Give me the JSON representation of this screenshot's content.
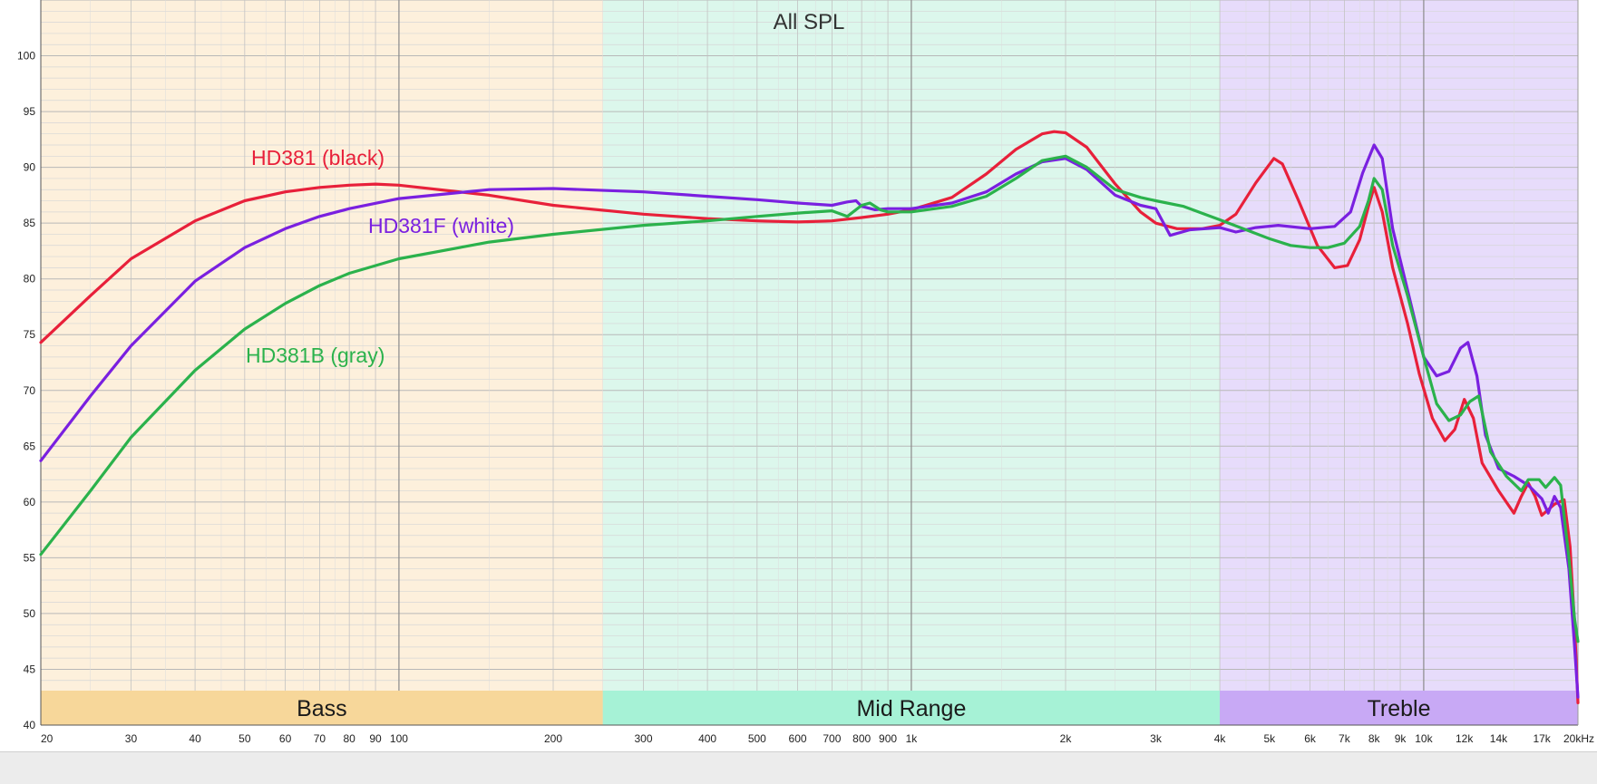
{
  "chart_data": {
    "type": "line",
    "title": "All SPL",
    "xscale": "log",
    "xlim": [
      20,
      20000
    ],
    "ylim": [
      40,
      105
    ],
    "grid": true,
    "y_ticks": [
      "40",
      "45",
      "50",
      "55",
      "60",
      "65",
      "70",
      "75",
      "80",
      "85",
      "90",
      "95",
      "100"
    ],
    "x_ticks": [
      {
        "v": 20,
        "label": "20"
      },
      {
        "v": 30,
        "label": "30"
      },
      {
        "v": 40,
        "label": "40"
      },
      {
        "v": 50,
        "label": "50"
      },
      {
        "v": 60,
        "label": "60"
      },
      {
        "v": 70,
        "label": "70"
      },
      {
        "v": 80,
        "label": "80"
      },
      {
        "v": 90,
        "label": "90"
      },
      {
        "v": 100,
        "label": "100"
      },
      {
        "v": 200,
        "label": "200"
      },
      {
        "v": 300,
        "label": "300"
      },
      {
        "v": 400,
        "label": "400"
      },
      {
        "v": 500,
        "label": "500"
      },
      {
        "v": 600,
        "label": "600"
      },
      {
        "v": 700,
        "label": "700"
      },
      {
        "v": 800,
        "label": "800"
      },
      {
        "v": 900,
        "label": "900"
      },
      {
        "v": 1000,
        "label": "1k"
      },
      {
        "v": 2000,
        "label": "2k"
      },
      {
        "v": 3000,
        "label": "3k"
      },
      {
        "v": 4000,
        "label": "4k"
      },
      {
        "v": 5000,
        "label": "5k"
      },
      {
        "v": 6000,
        "label": "6k"
      },
      {
        "v": 7000,
        "label": "7k"
      },
      {
        "v": 8000,
        "label": "8k"
      },
      {
        "v": 9000,
        "label": "9k"
      },
      {
        "v": 10000,
        "label": "10k"
      },
      {
        "v": 12000,
        "label": "12k"
      },
      {
        "v": 14000,
        "label": "14k"
      },
      {
        "v": 17000,
        "label": "17k"
      },
      {
        "v": 20000,
        "label": "20kHz"
      }
    ],
    "bands": [
      {
        "label": "Bass",
        "from": 20,
        "to": 250,
        "fill": "#fdf0dc",
        "bar": "#f7d79a"
      },
      {
        "label": "Mid Range",
        "from": 250,
        "to": 4000,
        "fill": "#dcf7ec",
        "bar": "#a6f2d6"
      },
      {
        "label": "Treble",
        "from": 4000,
        "to": 20000,
        "fill": "#e7dcfb",
        "bar": "#c8a9f5"
      }
    ],
    "series": [
      {
        "name": "HD381 (black)",
        "color": "#e8203a",
        "points": [
          [
            20,
            74.3
          ],
          [
            25,
            78.5
          ],
          [
            30,
            81.8
          ],
          [
            40,
            85.2
          ],
          [
            50,
            87.0
          ],
          [
            60,
            87.8
          ],
          [
            70,
            88.2
          ],
          [
            80,
            88.4
          ],
          [
            90,
            88.5
          ],
          [
            100,
            88.4
          ],
          [
            150,
            87.5
          ],
          [
            200,
            86.6
          ],
          [
            300,
            85.8
          ],
          [
            400,
            85.4
          ],
          [
            500,
            85.2
          ],
          [
            600,
            85.1
          ],
          [
            700,
            85.2
          ],
          [
            800,
            85.5
          ],
          [
            900,
            85.8
          ],
          [
            1000,
            86.2
          ],
          [
            1200,
            87.3
          ],
          [
            1400,
            89.4
          ],
          [
            1600,
            91.6
          ],
          [
            1800,
            93.0
          ],
          [
            1900,
            93.2
          ],
          [
            2000,
            93.1
          ],
          [
            2200,
            91.8
          ],
          [
            2500,
            88.5
          ],
          [
            2800,
            86.0
          ],
          [
            3000,
            85.0
          ],
          [
            3300,
            84.5
          ],
          [
            3700,
            84.5
          ],
          [
            4000,
            84.8
          ],
          [
            4300,
            85.8
          ],
          [
            4700,
            88.6
          ],
          [
            5100,
            90.8
          ],
          [
            5300,
            90.3
          ],
          [
            5700,
            87.0
          ],
          [
            6200,
            83.0
          ],
          [
            6700,
            81.0
          ],
          [
            7100,
            81.2
          ],
          [
            7500,
            83.5
          ],
          [
            7800,
            86.5
          ],
          [
            8000,
            88.2
          ],
          [
            8300,
            86.0
          ],
          [
            8700,
            81.0
          ],
          [
            9300,
            76.0
          ],
          [
            9800,
            71.5
          ],
          [
            10400,
            67.5
          ],
          [
            11000,
            65.5
          ],
          [
            11500,
            66.5
          ],
          [
            12000,
            69.2
          ],
          [
            12500,
            67.5
          ],
          [
            13000,
            63.5
          ],
          [
            14000,
            61.0
          ],
          [
            15000,
            59.0
          ],
          [
            15500,
            60.5
          ],
          [
            16000,
            61.7
          ],
          [
            16500,
            60.5
          ],
          [
            17000,
            58.8
          ],
          [
            18000,
            59.8
          ],
          [
            18800,
            60.2
          ],
          [
            19300,
            56.0
          ],
          [
            19700,
            49.0
          ],
          [
            20000,
            42.0
          ]
        ]
      },
      {
        "name": "HD381F (white)",
        "color": "#7a20e0",
        "points": [
          [
            20,
            63.7
          ],
          [
            25,
            69.5
          ],
          [
            30,
            74.0
          ],
          [
            40,
            79.8
          ],
          [
            50,
            82.8
          ],
          [
            60,
            84.5
          ],
          [
            70,
            85.6
          ],
          [
            80,
            86.3
          ],
          [
            100,
            87.2
          ],
          [
            150,
            88.0
          ],
          [
            200,
            88.1
          ],
          [
            300,
            87.8
          ],
          [
            400,
            87.4
          ],
          [
            500,
            87.1
          ],
          [
            600,
            86.8
          ],
          [
            700,
            86.6
          ],
          [
            750,
            86.9
          ],
          [
            780,
            87.0
          ],
          [
            800,
            86.5
          ],
          [
            850,
            86.2
          ],
          [
            900,
            86.3
          ],
          [
            1000,
            86.3
          ],
          [
            1200,
            86.8
          ],
          [
            1400,
            87.8
          ],
          [
            1600,
            89.4
          ],
          [
            1800,
            90.5
          ],
          [
            2000,
            90.8
          ],
          [
            2200,
            89.8
          ],
          [
            2500,
            87.5
          ],
          [
            2800,
            86.6
          ],
          [
            3000,
            86.3
          ],
          [
            3200,
            83.9
          ],
          [
            3500,
            84.4
          ],
          [
            4000,
            84.6
          ],
          [
            4300,
            84.2
          ],
          [
            4700,
            84.6
          ],
          [
            5200,
            84.8
          ],
          [
            6000,
            84.5
          ],
          [
            6700,
            84.7
          ],
          [
            7200,
            86.0
          ],
          [
            7600,
            89.5
          ],
          [
            8000,
            92.0
          ],
          [
            8300,
            90.8
          ],
          [
            8700,
            84.5
          ],
          [
            9300,
            79.0
          ],
          [
            10000,
            73.0
          ],
          [
            10600,
            71.3
          ],
          [
            11200,
            71.7
          ],
          [
            11800,
            73.8
          ],
          [
            12200,
            74.3
          ],
          [
            12700,
            71.3
          ],
          [
            13200,
            66.0
          ],
          [
            14000,
            63.0
          ],
          [
            15000,
            62.3
          ],
          [
            16000,
            61.5
          ],
          [
            17000,
            60.3
          ],
          [
            17500,
            59.0
          ],
          [
            18000,
            60.5
          ],
          [
            18500,
            59.5
          ],
          [
            19200,
            54.0
          ],
          [
            19700,
            47.0
          ],
          [
            20000,
            42.5
          ]
        ]
      },
      {
        "name": "HD381B (gray)",
        "color": "#2bb24c",
        "points": [
          [
            20,
            55.3
          ],
          [
            25,
            61.0
          ],
          [
            30,
            65.8
          ],
          [
            40,
            71.8
          ],
          [
            50,
            75.5
          ],
          [
            60,
            77.8
          ],
          [
            70,
            79.4
          ],
          [
            80,
            80.5
          ],
          [
            100,
            81.8
          ],
          [
            150,
            83.3
          ],
          [
            200,
            84.0
          ],
          [
            300,
            84.8
          ],
          [
            400,
            85.2
          ],
          [
            500,
            85.6
          ],
          [
            600,
            85.9
          ],
          [
            700,
            86.1
          ],
          [
            750,
            85.6
          ],
          [
            800,
            86.6
          ],
          [
            830,
            86.8
          ],
          [
            870,
            86.2
          ],
          [
            900,
            86.0
          ],
          [
            1000,
            86.0
          ],
          [
            1200,
            86.5
          ],
          [
            1400,
            87.4
          ],
          [
            1600,
            89.0
          ],
          [
            1800,
            90.6
          ],
          [
            2000,
            91.0
          ],
          [
            2200,
            90.0
          ],
          [
            2500,
            88.0
          ],
          [
            2800,
            87.3
          ],
          [
            3000,
            87.0
          ],
          [
            3400,
            86.5
          ],
          [
            4000,
            85.3
          ],
          [
            4500,
            84.4
          ],
          [
            5000,
            83.6
          ],
          [
            5500,
            83.0
          ],
          [
            6000,
            82.8
          ],
          [
            6500,
            82.8
          ],
          [
            7000,
            83.2
          ],
          [
            7500,
            84.7
          ],
          [
            7800,
            87.0
          ],
          [
            8000,
            89.0
          ],
          [
            8300,
            88.0
          ],
          [
            8700,
            83.0
          ],
          [
            9300,
            78.5
          ],
          [
            10000,
            73.0
          ],
          [
            10600,
            68.8
          ],
          [
            11200,
            67.3
          ],
          [
            11800,
            67.8
          ],
          [
            12300,
            69.0
          ],
          [
            12800,
            69.5
          ],
          [
            13500,
            64.5
          ],
          [
            14500,
            62.3
          ],
          [
            15500,
            61.0
          ],
          [
            16000,
            62.0
          ],
          [
            16800,
            62.0
          ],
          [
            17300,
            61.3
          ],
          [
            18000,
            62.2
          ],
          [
            18500,
            61.5
          ],
          [
            19200,
            55.0
          ],
          [
            19700,
            49.5
          ],
          [
            20000,
            47.5
          ]
        ]
      }
    ],
    "legend_labels": [
      {
        "series": 0,
        "text": "HD381 (black)"
      },
      {
        "series": 1,
        "text": "HD381F (white)"
      },
      {
        "series": 2,
        "text": "HD381B (gray)"
      }
    ]
  }
}
